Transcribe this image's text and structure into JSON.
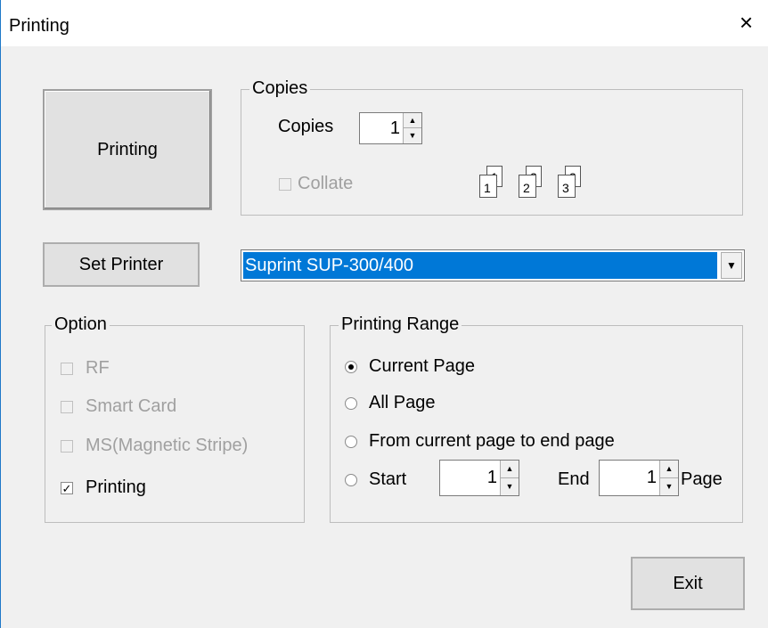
{
  "window": {
    "title": "Printing",
    "close_glyph": "×"
  },
  "buttons": {
    "printing": "Printing",
    "set_printer": "Set Printer",
    "exit": "Exit"
  },
  "copies": {
    "legend": "Copies",
    "label": "Copies",
    "value": "1",
    "collate_label": "Collate",
    "collate_checked": false,
    "collate_pages": [
      "1",
      "1",
      "2",
      "2",
      "3",
      "3"
    ]
  },
  "printer": {
    "selected": "Suprint SUP-300/400"
  },
  "option": {
    "legend": "Option",
    "items": [
      {
        "label": "RF",
        "checked": false,
        "enabled": false
      },
      {
        "label": "Smart Card",
        "checked": false,
        "enabled": false
      },
      {
        "label": "MS(Magnetic Stripe)",
        "checked": false,
        "enabled": false
      },
      {
        "label": "Printing",
        "checked": true,
        "enabled": true
      }
    ]
  },
  "range": {
    "legend": "Printing Range",
    "options": [
      {
        "label": "Current Page",
        "selected": true
      },
      {
        "label": "All Page",
        "selected": false
      },
      {
        "label": "From current page to end page",
        "selected": false
      },
      {
        "label": "Start",
        "selected": false
      }
    ],
    "start_value": "1",
    "end_label": "End",
    "end_value": "1",
    "page_label": "Page"
  },
  "icons": {
    "check": "✓",
    "up": "▲",
    "down": "▼"
  }
}
